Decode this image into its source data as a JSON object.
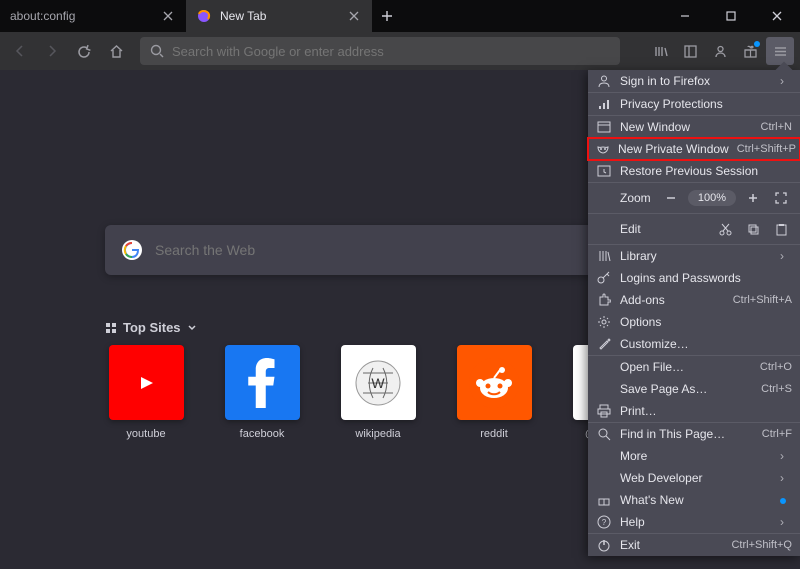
{
  "tabs": [
    {
      "title": "about:config",
      "active": false
    },
    {
      "title": "New Tab",
      "active": true
    }
  ],
  "urlbar_placeholder": "Search with Google or enter address",
  "search_placeholder": "Search the Web",
  "topsites_label": "Top Sites",
  "tiles": [
    {
      "label": "youtube",
      "bg": "#ff0000"
    },
    {
      "label": "facebook",
      "bg": "#1877f2"
    },
    {
      "label": "wikipedia",
      "bg": "#ffffff"
    },
    {
      "label": "reddit",
      "bg": "#ff5700"
    },
    {
      "label": "@amazon",
      "bg": "#ffffff"
    }
  ],
  "menu": {
    "signin": "Sign in to Firefox",
    "privacy": "Privacy Protections",
    "new_window": "New Window",
    "new_window_sc": "Ctrl+N",
    "new_private": "New Private Window",
    "new_private_sc": "Ctrl+Shift+P",
    "restore": "Restore Previous Session",
    "zoom": "Zoom",
    "zoom_val": "100%",
    "edit": "Edit",
    "library": "Library",
    "logins": "Logins and Passwords",
    "addons": "Add-ons",
    "addons_sc": "Ctrl+Shift+A",
    "options": "Options",
    "customize": "Customize…",
    "open_file": "Open File…",
    "open_file_sc": "Ctrl+O",
    "save_page": "Save Page As…",
    "save_page_sc": "Ctrl+S",
    "print": "Print…",
    "find": "Find in This Page…",
    "find_sc": "Ctrl+F",
    "more": "More",
    "webdev": "Web Developer",
    "whatsnew": "What's New",
    "help": "Help",
    "exit": "Exit",
    "exit_sc": "Ctrl+Shift+Q"
  }
}
